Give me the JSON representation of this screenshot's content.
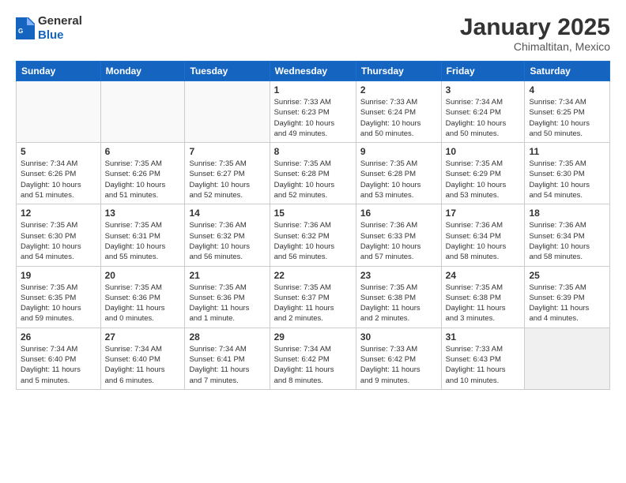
{
  "header": {
    "logo_general": "General",
    "logo_blue": "Blue",
    "month_title": "January 2025",
    "location": "Chimaltitan, Mexico"
  },
  "weekdays": [
    "Sunday",
    "Monday",
    "Tuesday",
    "Wednesday",
    "Thursday",
    "Friday",
    "Saturday"
  ],
  "rows": [
    [
      {
        "num": "",
        "info": "",
        "empty": true
      },
      {
        "num": "",
        "info": "",
        "empty": true
      },
      {
        "num": "",
        "info": "",
        "empty": true
      },
      {
        "num": "1",
        "info": "Sunrise: 7:33 AM\nSunset: 6:23 PM\nDaylight: 10 hours\nand 49 minutes."
      },
      {
        "num": "2",
        "info": "Sunrise: 7:33 AM\nSunset: 6:24 PM\nDaylight: 10 hours\nand 50 minutes."
      },
      {
        "num": "3",
        "info": "Sunrise: 7:34 AM\nSunset: 6:24 PM\nDaylight: 10 hours\nand 50 minutes."
      },
      {
        "num": "4",
        "info": "Sunrise: 7:34 AM\nSunset: 6:25 PM\nDaylight: 10 hours\nand 50 minutes."
      }
    ],
    [
      {
        "num": "5",
        "info": "Sunrise: 7:34 AM\nSunset: 6:26 PM\nDaylight: 10 hours\nand 51 minutes."
      },
      {
        "num": "6",
        "info": "Sunrise: 7:35 AM\nSunset: 6:26 PM\nDaylight: 10 hours\nand 51 minutes."
      },
      {
        "num": "7",
        "info": "Sunrise: 7:35 AM\nSunset: 6:27 PM\nDaylight: 10 hours\nand 52 minutes."
      },
      {
        "num": "8",
        "info": "Sunrise: 7:35 AM\nSunset: 6:28 PM\nDaylight: 10 hours\nand 52 minutes."
      },
      {
        "num": "9",
        "info": "Sunrise: 7:35 AM\nSunset: 6:28 PM\nDaylight: 10 hours\nand 53 minutes."
      },
      {
        "num": "10",
        "info": "Sunrise: 7:35 AM\nSunset: 6:29 PM\nDaylight: 10 hours\nand 53 minutes."
      },
      {
        "num": "11",
        "info": "Sunrise: 7:35 AM\nSunset: 6:30 PM\nDaylight: 10 hours\nand 54 minutes."
      }
    ],
    [
      {
        "num": "12",
        "info": "Sunrise: 7:35 AM\nSunset: 6:30 PM\nDaylight: 10 hours\nand 54 minutes."
      },
      {
        "num": "13",
        "info": "Sunrise: 7:35 AM\nSunset: 6:31 PM\nDaylight: 10 hours\nand 55 minutes."
      },
      {
        "num": "14",
        "info": "Sunrise: 7:36 AM\nSunset: 6:32 PM\nDaylight: 10 hours\nand 56 minutes."
      },
      {
        "num": "15",
        "info": "Sunrise: 7:36 AM\nSunset: 6:32 PM\nDaylight: 10 hours\nand 56 minutes."
      },
      {
        "num": "16",
        "info": "Sunrise: 7:36 AM\nSunset: 6:33 PM\nDaylight: 10 hours\nand 57 minutes."
      },
      {
        "num": "17",
        "info": "Sunrise: 7:36 AM\nSunset: 6:34 PM\nDaylight: 10 hours\nand 58 minutes."
      },
      {
        "num": "18",
        "info": "Sunrise: 7:36 AM\nSunset: 6:34 PM\nDaylight: 10 hours\nand 58 minutes."
      }
    ],
    [
      {
        "num": "19",
        "info": "Sunrise: 7:35 AM\nSunset: 6:35 PM\nDaylight: 10 hours\nand 59 minutes."
      },
      {
        "num": "20",
        "info": "Sunrise: 7:35 AM\nSunset: 6:36 PM\nDaylight: 11 hours\nand 0 minutes."
      },
      {
        "num": "21",
        "info": "Sunrise: 7:35 AM\nSunset: 6:36 PM\nDaylight: 11 hours\nand 1 minute."
      },
      {
        "num": "22",
        "info": "Sunrise: 7:35 AM\nSunset: 6:37 PM\nDaylight: 11 hours\nand 2 minutes."
      },
      {
        "num": "23",
        "info": "Sunrise: 7:35 AM\nSunset: 6:38 PM\nDaylight: 11 hours\nand 2 minutes."
      },
      {
        "num": "24",
        "info": "Sunrise: 7:35 AM\nSunset: 6:38 PM\nDaylight: 11 hours\nand 3 minutes."
      },
      {
        "num": "25",
        "info": "Sunrise: 7:35 AM\nSunset: 6:39 PM\nDaylight: 11 hours\nand 4 minutes."
      }
    ],
    [
      {
        "num": "26",
        "info": "Sunrise: 7:34 AM\nSunset: 6:40 PM\nDaylight: 11 hours\nand 5 minutes."
      },
      {
        "num": "27",
        "info": "Sunrise: 7:34 AM\nSunset: 6:40 PM\nDaylight: 11 hours\nand 6 minutes."
      },
      {
        "num": "28",
        "info": "Sunrise: 7:34 AM\nSunset: 6:41 PM\nDaylight: 11 hours\nand 7 minutes."
      },
      {
        "num": "29",
        "info": "Sunrise: 7:34 AM\nSunset: 6:42 PM\nDaylight: 11 hours\nand 8 minutes."
      },
      {
        "num": "30",
        "info": "Sunrise: 7:33 AM\nSunset: 6:42 PM\nDaylight: 11 hours\nand 9 minutes."
      },
      {
        "num": "31",
        "info": "Sunrise: 7:33 AM\nSunset: 6:43 PM\nDaylight: 11 hours\nand 10 minutes."
      },
      {
        "num": "",
        "info": "",
        "empty": true,
        "shaded": true
      }
    ]
  ]
}
